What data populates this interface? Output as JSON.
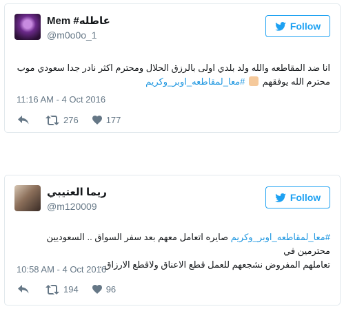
{
  "tweets": [
    {
      "display_name": "Mem #عاطله",
      "handle": "@m0o0o_1",
      "follow_label": "Follow",
      "text_line1": "انا ضد المقاطعه والله ولد بلدي اولى بالرزق الحلال ومحترم اكثر نادر جدا سعودي موب",
      "text_line2_plain": "محترم الله يوفقهم ",
      "hashtag": "#معا_لمقاطعه_اوبر_وكريم",
      "timestamp": "11:16 AM - 4 Oct 2016",
      "retweets": "276",
      "likes": "177"
    },
    {
      "display_name": "ريما العتيبي",
      "handle": "@m120009",
      "follow_label": "Follow",
      "hashtag": "#معا_لمقاطعه_اوبر_وكريم",
      "text_line1_rest": " صايره اتعامل معهم بعد سفر السواق .. السعوديين محترمين في",
      "text_line2": "تعاملهم المفروض نشجعهم للعمل قطع الاعناق ولاقطع الارزاق .",
      "timestamp": "10:58 AM - 4 Oct 2016",
      "retweets": "194",
      "likes": "96"
    }
  ],
  "colors": {
    "accent": "#1da1f2",
    "hashtag": "#1b95e0",
    "muted": "#657786",
    "border": "#e1e8ed"
  },
  "icons": [
    "twitter-bird-icon",
    "reply-icon",
    "retweet-icon",
    "heart-icon",
    "thumbs-up-emoji"
  ]
}
